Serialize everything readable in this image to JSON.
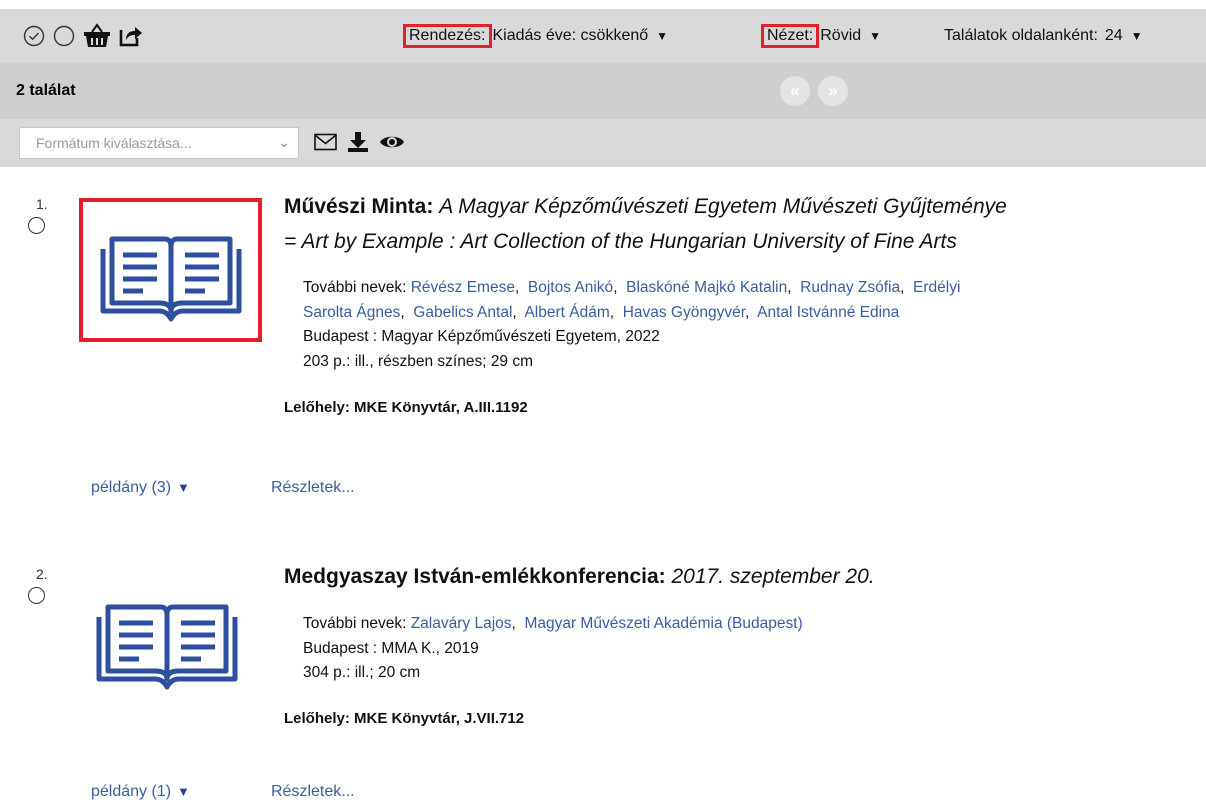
{
  "toolbar": {
    "icons": [
      "check-circle-icon",
      "circle-icon",
      "basket-icon",
      "share-icon"
    ],
    "sort_label": "Rendezés:",
    "sort_value": "Kiadás éve: csökkenő",
    "view_label": "Nézet:",
    "view_value": "Rövid",
    "per_page_label": "Találatok oldalanként:",
    "per_page_value": "24"
  },
  "results": {
    "count_label": "2 találat",
    "prev_glyph": "«",
    "next_glyph": "»"
  },
  "format": {
    "placeholder": "Formátum kiválasztása...",
    "icons": [
      "mail-icon",
      "download-icon",
      "eye-icon"
    ]
  },
  "records": [
    {
      "number": "1.",
      "title_bold": "Művészi Minta",
      "title_sep": ": ",
      "title_italic_1": "A Magyar Képzőművészeti Egyetem Művészeti Gyűjteménye",
      "title_italic_2": "= Art by Example : Art Collection of the Hungarian University of Fine Arts",
      "names_label": "További nevek: ",
      "names_line1": [
        "Révész Emese",
        "Bojtos Anikó",
        "Blaskóné Majkó Katalin",
        "Rudnay Zsófia",
        "Erdélyi"
      ],
      "names_line2": [
        "Sarolta Ágnes",
        "Gabelics Antal",
        "Albert Ádám",
        "Havas Gyöngyvér",
        "Antal Istvánné Edina"
      ],
      "publisher": "Budapest : Magyar Képzőművészeti Egyetem, 2022",
      "physical": "203 p.: ill., részben színes; 29 cm",
      "location": "Lelőhely: MKE Könyvtár, A.III.1192",
      "copies": "példány (3)",
      "details": "Részletek..."
    },
    {
      "number": "2.",
      "title_bold": "Medgyaszay István-emlékkonferencia",
      "title_sep": ": ",
      "title_italic_1": "2017. szeptember 20.",
      "names_label": "További nevek: ",
      "names_line1": [
        "Zalaváry Lajos",
        "Magyar Művészeti Akadémia (Budapest)"
      ],
      "publisher": "Budapest : MMA K., 2019",
      "physical": "304 p.: ill.; 20 cm",
      "location": "Lelőhely: MKE Könyvtár, J.VII.712",
      "copies": "példány (1)",
      "details": "Részletek..."
    }
  ],
  "colors": {
    "link": "#3a5e9c",
    "book_icon": "#2d4f9e",
    "highlight": "#e0202a",
    "toolbar_bg": "#d9d9d9"
  }
}
